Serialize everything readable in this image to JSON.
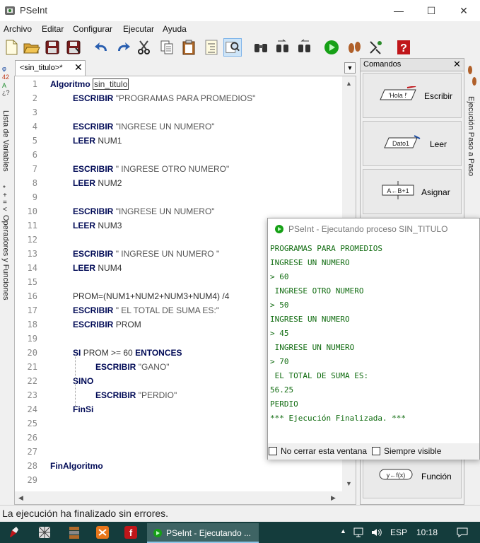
{
  "window": {
    "title": "PSeInt",
    "minimize": "—",
    "maximize": "☐",
    "close": "✕"
  },
  "menu": [
    "Archivo",
    "Editar",
    "Configurar",
    "Ejecutar",
    "Ayuda"
  ],
  "sidebar_left": {
    "variables_label": "Lista de Variables",
    "operators_label": "Operadores y Funciones"
  },
  "sidebar_right": {
    "step_label": "Ejecución Paso a Paso"
  },
  "editor": {
    "tab_label": "<sin_titulo>*",
    "tab_close": "✕",
    "lines": [
      {
        "n": "1",
        "kw": "Algoritmo",
        "rest": "sin_titulo"
      },
      {
        "n": "2",
        "kw": "ESCRIBIR",
        "rest": "\"PROGRAMAS PARA PROMEDIOS\""
      },
      {
        "n": "3"
      },
      {
        "n": "4",
        "kw": "ESCRIBIR",
        "rest": "\"INGRESE UN NUMERO\""
      },
      {
        "n": "5",
        "kw": "LEER",
        "rest": "NUM1"
      },
      {
        "n": "6"
      },
      {
        "n": "7",
        "kw": "ESCRIBIR",
        "rest": "\" INGRESE OTRO NUMERO\""
      },
      {
        "n": "8",
        "kw": "LEER",
        "rest": "NUM2"
      },
      {
        "n": "9"
      },
      {
        "n": "10",
        "kw": "ESCRIBIR",
        "rest": "\"INGRESE UN NUMERO\""
      },
      {
        "n": "11",
        "kw": "LEER",
        "rest": "NUM3"
      },
      {
        "n": "12"
      },
      {
        "n": "13",
        "kw": "ESCRIBIR",
        "rest": "\" INGRESE UN NUMERO \""
      },
      {
        "n": "14",
        "kw": "LEER",
        "rest": "NUM4"
      },
      {
        "n": "15"
      },
      {
        "n": "16",
        "rest": "PROM=(NUM1+NUM2+NUM3+NUM4) /4"
      },
      {
        "n": "17",
        "kw": "ESCRIBIR",
        "rest": "\" EL TOTAL DE SUMA ES:\""
      },
      {
        "n": "18",
        "kw": "ESCRIBIR",
        "rest": "PROM"
      },
      {
        "n": "19"
      },
      {
        "n": "20",
        "kw": "SI",
        "rest": "PROM >= 60",
        "kw2": "ENTONCES"
      },
      {
        "n": "21",
        "kw": "ESCRIBIR",
        "rest": "\"GANO\""
      },
      {
        "n": "22",
        "kw": "SINO"
      },
      {
        "n": "23",
        "kw": "ESCRIBIR",
        "rest": "\"PERDIO\""
      },
      {
        "n": "24",
        "kw": "FinSi"
      },
      {
        "n": "25"
      },
      {
        "n": "26"
      },
      {
        "n": "27"
      },
      {
        "n": "28",
        "kw": "FinAlgoritmo"
      },
      {
        "n": "29"
      }
    ]
  },
  "commands": {
    "header": "Comandos",
    "close": "✕",
    "items": [
      {
        "label": "Escribir",
        "glyph": "'Hola !'"
      },
      {
        "label": "Leer",
        "glyph": "Dato1"
      },
      {
        "label": "Asignar",
        "glyph": "A←B+1"
      },
      {
        "label": "Función",
        "glyph": "y←f(x)"
      }
    ]
  },
  "execution": {
    "title": "PSeInt - Ejecutando proceso SIN_TITULO",
    "output": [
      "PROGRAMAS PARA PROMEDIOS",
      "INGRESE UN NUMERO",
      "> 60",
      " INGRESE OTRO NUMERO",
      "> 50",
      "INGRESE UN NUMERO",
      "> 45",
      " INGRESE UN NUMERO",
      "> 70",
      " EL TOTAL DE SUMA ES:",
      "56.25",
      "PERDIO",
      "*** Ejecución Finalizada. ***"
    ],
    "no_close_label": "No cerrar esta ventana",
    "always_visible_label": "Siempre visible"
  },
  "status": "La ejecución ha finalizado sin errores.",
  "taskbar": {
    "active_item": "PSeInt - Ejecutando ...",
    "language": "ESP",
    "time": "10:18"
  },
  "colors": {
    "keyword": "#000a56",
    "output": "#0f6b0f",
    "taskbar": "#143c3c"
  }
}
